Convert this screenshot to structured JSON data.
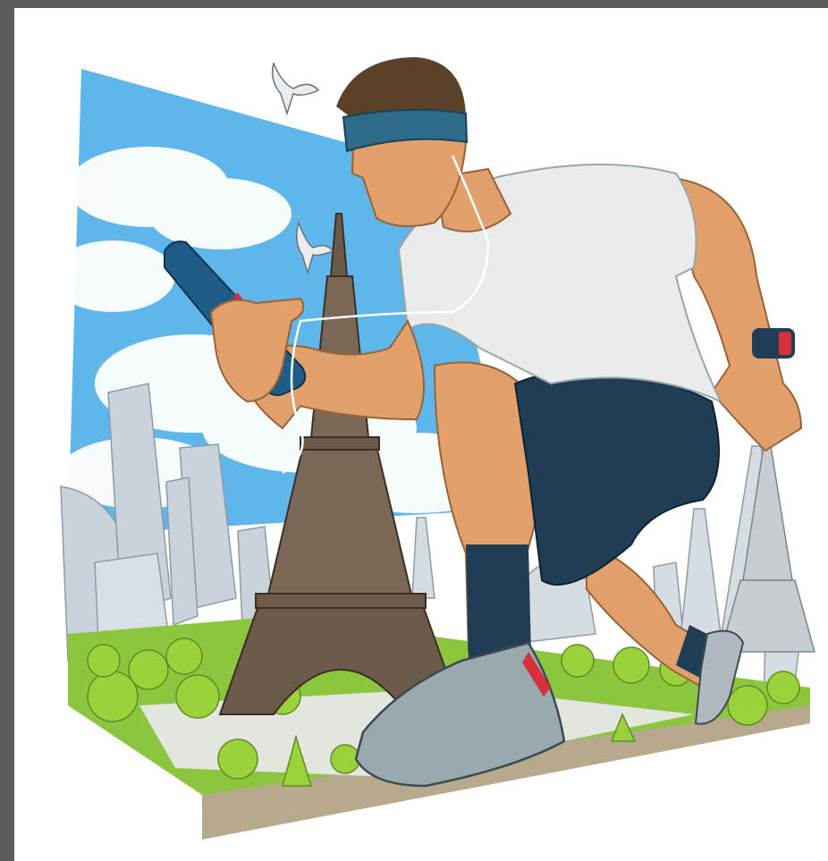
{
  "viewer": {
    "background_color": "#5a5b5f",
    "canvas_color": "#ffffff"
  },
  "illustration": {
    "palette": {
      "sky": "#5fb6ea",
      "cloud": "#ffffff",
      "grass": "#8cc63f",
      "tree": "#9bd23c",
      "tower": "#6b5a4a",
      "skin": "#e2a06c",
      "shirt": "#e8ecea",
      "shorts": "#1f3e55",
      "headband": "#2e6b8a",
      "phone": "#1f5d86",
      "shoe": "#9aa8b0",
      "shoe_accent": "#d6303a",
      "building": "#c9d3da"
    },
    "icons": [
      "bird-icon",
      "smartphone-icon",
      "smartwatch-icon",
      "earphones-icon"
    ]
  }
}
